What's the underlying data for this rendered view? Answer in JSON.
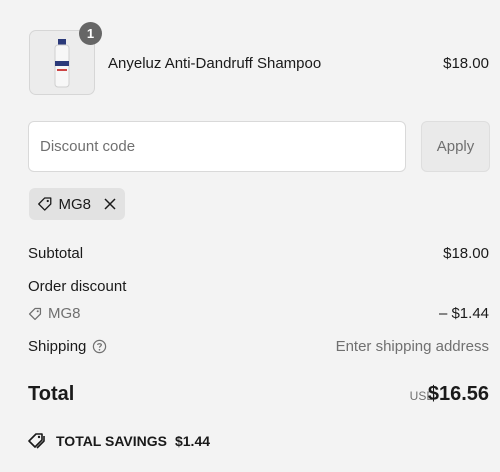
{
  "product": {
    "name": "Anyeluz Anti-Dandruff Shampoo",
    "price": "$18.00",
    "quantity": "1",
    "image_icon": "shampoo-bottle-icon"
  },
  "discount": {
    "placeholder": "Discount code",
    "value": "",
    "apply_label": "Apply",
    "applied_code": "MG8"
  },
  "summary": {
    "subtotal_label": "Subtotal",
    "subtotal_value": "$18.00",
    "order_discount_label": "Order discount",
    "order_discount_code": "MG8",
    "order_discount_value": "– $1.44",
    "shipping_label": "Shipping",
    "shipping_value": "Enter shipping address",
    "total_label": "Total",
    "total_currency": "USD",
    "total_value": "$16.56",
    "savings_label": "TOTAL SAVINGS",
    "savings_value": "$1.44"
  },
  "colors": {
    "background": "#f3f3f3",
    "muted_text": "#707070",
    "badge": "#666666",
    "chip": "#e2e2e2"
  }
}
